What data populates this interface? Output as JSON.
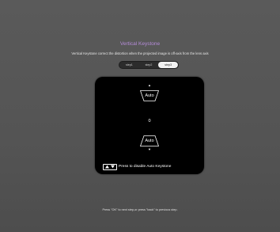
{
  "header": {
    "title": "Vertical Keystone",
    "subtitle": "Vertical Keystone correct the distortion when the projected image is off-axis from the lens axis"
  },
  "steps": {
    "items": [
      "step1",
      "step2",
      "step3"
    ],
    "active_index": 2
  },
  "keystone": {
    "top_label": "Auto",
    "bottom_label": "Auto",
    "value": "0",
    "up_icon": "up-arrow-icon",
    "down_icon": "down-arrow-icon"
  },
  "hint": {
    "icon": "up-down-keys-icon",
    "text": "Press to disable Auto Keystone"
  },
  "footer": {
    "text": "Press \"OK\" to next step,or press \"back\" to previous step."
  },
  "colors": {
    "title": "#b58cd9",
    "background": "#555555",
    "panel": "#000000"
  }
}
